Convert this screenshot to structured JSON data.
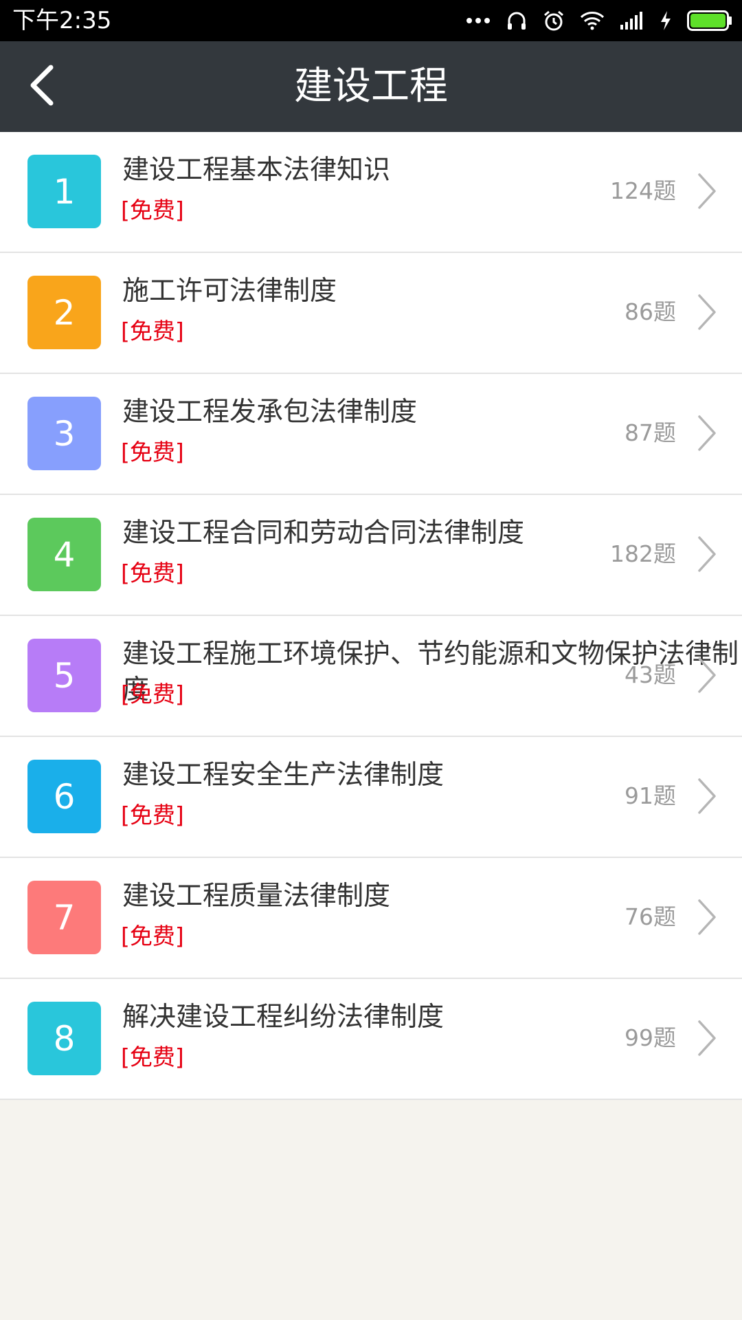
{
  "status_bar": {
    "time": "下午2:35",
    "icons": [
      "more-dots-icon",
      "headset-icon",
      "alarm-icon",
      "wifi-icon",
      "signal-icon",
      "charging-icon",
      "battery-icon"
    ]
  },
  "header": {
    "title": "建设工程",
    "back_icon": "chevron-left-icon"
  },
  "items": [
    {
      "number": "1",
      "title": "建设工程基本法律知识",
      "tag": "[免费]",
      "count": "124题",
      "color": "#29c6db"
    },
    {
      "number": "2",
      "title": "施工许可法律制度",
      "tag": "[免费]",
      "count": "86题",
      "color": "#f9a51b"
    },
    {
      "number": "3",
      "title": "建设工程发承包法律制度",
      "tag": "[免费]",
      "count": "87题",
      "color": "#879ffd"
    },
    {
      "number": "4",
      "title": "建设工程合同和劳动合同法律制度",
      "tag": "[免费]",
      "count": "182题",
      "color": "#5cc95c"
    },
    {
      "number": "5",
      "title": "建设工程施工环境保护、节约能源和文物保护法律制度",
      "tag": "[免费]",
      "count": "43题",
      "color": "#b77cf7"
    },
    {
      "number": "6",
      "title": "建设工程安全生产法律制度",
      "tag": "[免费]",
      "count": "91题",
      "color": "#1aafea"
    },
    {
      "number": "7",
      "title": "建设工程质量法律制度",
      "tag": "[免费]",
      "count": "76题",
      "color": "#fd7a7a"
    },
    {
      "number": "8",
      "title": "解决建设工程纠纷法律制度",
      "tag": "[免费]",
      "count": "99题",
      "color": "#29c6db"
    }
  ],
  "colors": {
    "status_bar": "#000000",
    "title_bar": "#33383d",
    "tag": "#e60012",
    "count": "#9a9a9a",
    "background": "#f5f3ee"
  }
}
